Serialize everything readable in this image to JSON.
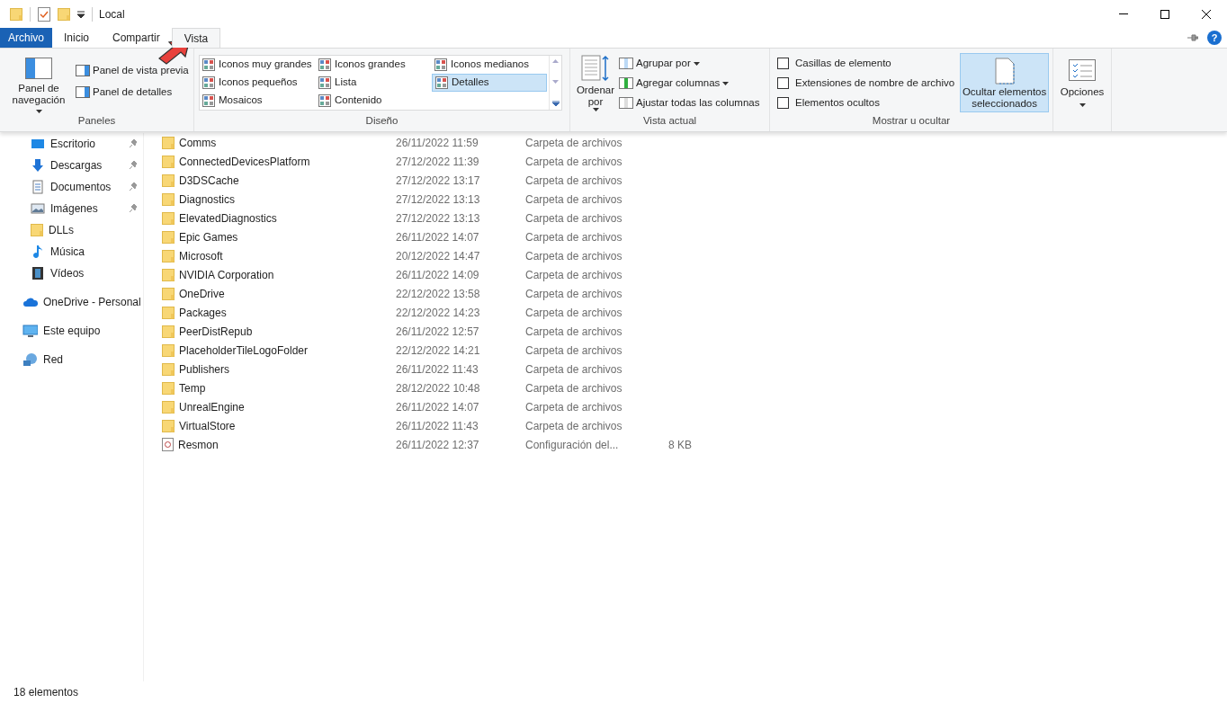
{
  "window": {
    "title": "Local"
  },
  "tabs": [
    {
      "label": "Archivo",
      "kind": "file",
      "selected": false
    },
    {
      "label": "Inicio",
      "kind": "tab",
      "selected": false
    },
    {
      "label": "Compartir",
      "kind": "tab",
      "selected": false
    },
    {
      "label": "Vista",
      "kind": "tab",
      "selected": true
    }
  ],
  "ribbon": {
    "panes": {
      "label": "Paneles",
      "nav_button": "Panel de navegación",
      "items": [
        "Panel de vista previa",
        "Panel de detalles"
      ]
    },
    "layout": {
      "label": "Diseño",
      "options": [
        {
          "label": "Iconos muy grandes",
          "selected": false
        },
        {
          "label": "Iconos grandes",
          "selected": false
        },
        {
          "label": "Iconos medianos",
          "selected": false
        },
        {
          "label": "Iconos pequeños",
          "selected": false
        },
        {
          "label": "Lista",
          "selected": false
        },
        {
          "label": "Detalles",
          "selected": true
        },
        {
          "label": "Mosaicos",
          "selected": false
        },
        {
          "label": "Contenido",
          "selected": false
        }
      ]
    },
    "current_view": {
      "label": "Vista actual",
      "sort_button": "Ordenar por",
      "items": [
        {
          "label": "Agrupar por",
          "dropdown": true
        },
        {
          "label": "Agregar columnas",
          "dropdown": true
        },
        {
          "label": "Ajustar todas las columnas",
          "dropdown": false
        }
      ]
    },
    "show_hide": {
      "label": "Mostrar u ocultar",
      "checkboxes": [
        {
          "label": "Casillas de elemento",
          "checked": false
        },
        {
          "label": "Extensiones de nombre de archivo",
          "checked": false
        },
        {
          "label": "Elementos ocultos",
          "checked": false
        }
      ],
      "hide_button": {
        "label": "Ocultar elementos seleccionados",
        "highlighted": true
      }
    },
    "options": {
      "label": "Opciones"
    }
  },
  "sidebar": {
    "sections": [
      {
        "items": [
          {
            "label": "Escritorio",
            "kind": "desktop",
            "pinned": true
          },
          {
            "label": "Descargas",
            "kind": "download",
            "pinned": true
          },
          {
            "label": "Documentos",
            "kind": "document",
            "pinned": true
          },
          {
            "label": "Imágenes",
            "kind": "image",
            "pinned": true
          },
          {
            "label": "DLLs",
            "kind": "folder",
            "pinned": false
          },
          {
            "label": "Música",
            "kind": "music",
            "pinned": false
          },
          {
            "label": "Vídeos",
            "kind": "video",
            "pinned": false
          }
        ]
      },
      {
        "items": [
          {
            "label": "OneDrive - Personal",
            "kind": "cloud",
            "pinned": false
          }
        ]
      },
      {
        "items": [
          {
            "label": "Este equipo",
            "kind": "computer",
            "pinned": false
          }
        ]
      },
      {
        "items": [
          {
            "label": "Red",
            "kind": "network",
            "pinned": false
          }
        ]
      }
    ]
  },
  "files": [
    {
      "name": "Comms",
      "date": "26/11/2022 11:59",
      "type": "Carpeta de archivos",
      "kind": "folder"
    },
    {
      "name": "ConnectedDevicesPlatform",
      "date": "27/12/2022 11:39",
      "type": "Carpeta de archivos",
      "kind": "folder"
    },
    {
      "name": "D3DSCache",
      "date": "27/12/2022 13:17",
      "type": "Carpeta de archivos",
      "kind": "folder"
    },
    {
      "name": "Diagnostics",
      "date": "27/12/2022 13:13",
      "type": "Carpeta de archivos",
      "kind": "folder"
    },
    {
      "name": "ElevatedDiagnostics",
      "date": "27/12/2022 13:13",
      "type": "Carpeta de archivos",
      "kind": "folder"
    },
    {
      "name": "Epic Games",
      "date": "26/11/2022 14:07",
      "type": "Carpeta de archivos",
      "kind": "folder"
    },
    {
      "name": "Microsoft",
      "date": "20/12/2022 14:47",
      "type": "Carpeta de archivos",
      "kind": "folder"
    },
    {
      "name": "NVIDIA Corporation",
      "date": "26/11/2022 14:09",
      "type": "Carpeta de archivos",
      "kind": "folder"
    },
    {
      "name": "OneDrive",
      "date": "22/12/2022 13:58",
      "type": "Carpeta de archivos",
      "kind": "folder"
    },
    {
      "name": "Packages",
      "date": "22/12/2022 14:23",
      "type": "Carpeta de archivos",
      "kind": "folder"
    },
    {
      "name": "PeerDistRepub",
      "date": "26/11/2022 12:57",
      "type": "Carpeta de archivos",
      "kind": "folder"
    },
    {
      "name": "PlaceholderTileLogoFolder",
      "date": "22/12/2022 14:21",
      "type": "Carpeta de archivos",
      "kind": "folder"
    },
    {
      "name": "Publishers",
      "date": "26/11/2022 11:43",
      "type": "Carpeta de archivos",
      "kind": "folder"
    },
    {
      "name": "Temp",
      "date": "28/12/2022 10:48",
      "type": "Carpeta de archivos",
      "kind": "folder"
    },
    {
      "name": "UnrealEngine",
      "date": "26/11/2022 14:07",
      "type": "Carpeta de archivos",
      "kind": "folder"
    },
    {
      "name": "VirtualStore",
      "date": "26/11/2022 11:43",
      "type": "Carpeta de archivos",
      "kind": "folder"
    },
    {
      "name": "Resmon",
      "date": "26/11/2022 12:37",
      "type": "Configuración del...",
      "size": "8 KB",
      "kind": "config"
    }
  ],
  "status_bar": {
    "count": "18 elementos"
  },
  "help_button": "?"
}
